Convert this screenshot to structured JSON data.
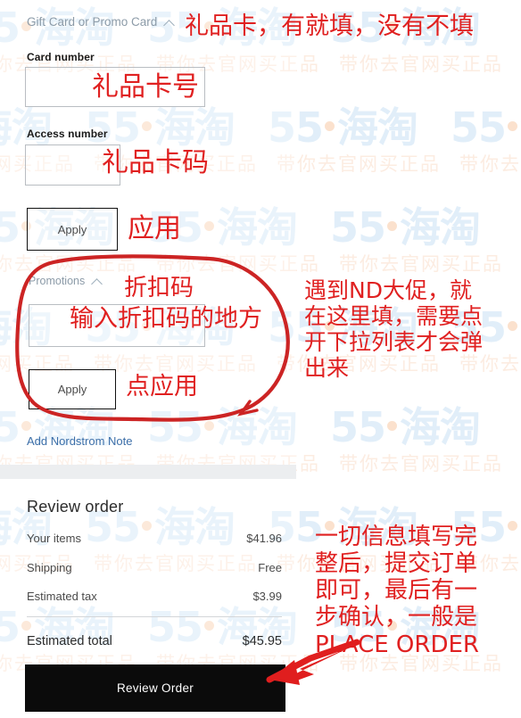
{
  "watermark": {
    "logo_text": "55",
    "logo_suffix": "海淘",
    "tagline": "带你去官网买正品",
    "logo_color": "#cfe4f5",
    "tagline_color": "#fae0cf",
    "dot_color": "#f8cfae"
  },
  "giftcard": {
    "section_title": "Gift Card or Promo Card",
    "card_number_label": "Card number",
    "card_number_value": "",
    "access_number_label": "Access number",
    "access_number_value": "",
    "apply_label": "Apply"
  },
  "promotions": {
    "section_title": "Promotions",
    "code_value": "",
    "apply_label": "Apply"
  },
  "nordstrom_note": {
    "link_label": "Add Nordstrom Note"
  },
  "review": {
    "title": "Review order",
    "rows": [
      {
        "label": "Your items",
        "value": "$41.96"
      },
      {
        "label": "Shipping",
        "value": "Free"
      },
      {
        "label": "Estimated tax",
        "value": "$3.99"
      }
    ],
    "total": {
      "label": "Estimated total",
      "value": "$45.95"
    },
    "submit_label": "Review Order"
  },
  "annotations": {
    "accent_color": "#e02020",
    "top": "礼品卡，有就填，没有不填",
    "card_number": "礼品卡号",
    "access_number": "礼品卡码",
    "apply_gift": "应用",
    "promo_title": "折扣码",
    "promo_input": "输入折扣码的地方",
    "apply_promo": "点应用",
    "right_promo_note": "遇到ND大促，就\n在这里填，需要点\n开下拉列表才会弹\n出来",
    "right_submit_note": "一切信息填写完\n整后，提交订单\n即可，最后有一\n步确认，一般是\nPLACE ORDER"
  }
}
